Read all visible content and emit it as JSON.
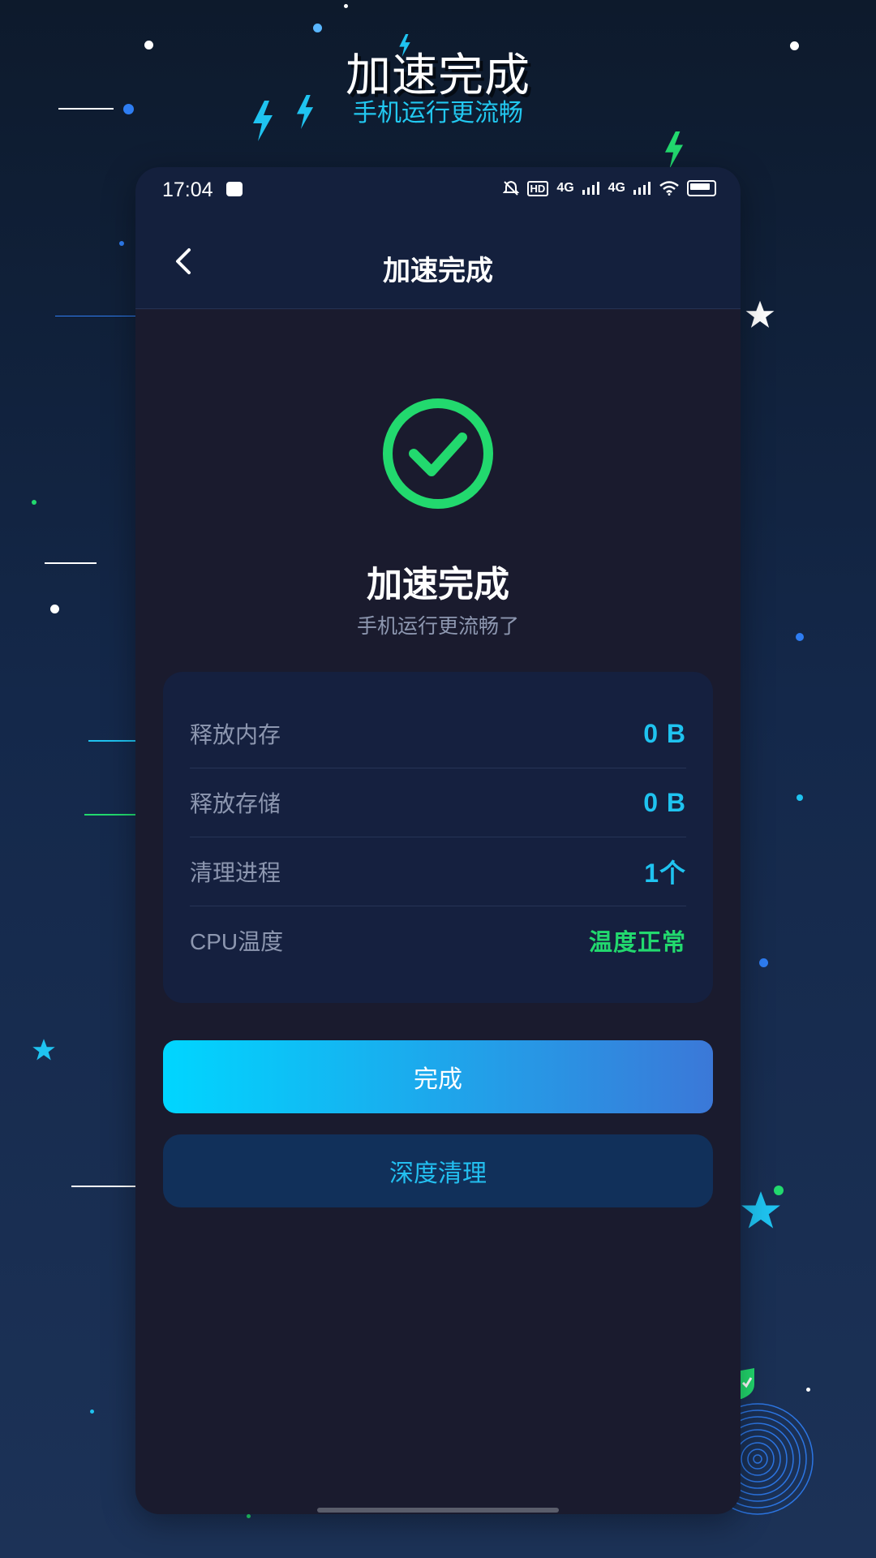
{
  "banner": {
    "title": "加速完成",
    "subtitle": "手机运行更流畅"
  },
  "status_bar": {
    "time": "17:04",
    "network_labels": [
      "HD",
      "4G",
      "4G"
    ]
  },
  "header": {
    "title": "加速完成",
    "back_icon": "chevron-left-icon"
  },
  "result": {
    "icon": "check-circle-icon",
    "title": "加速完成",
    "subtitle": "手机运行更流畅了"
  },
  "stats": [
    {
      "label": "释放内存",
      "value": "0 B"
    },
    {
      "label": "释放存储",
      "value": "0 B"
    },
    {
      "label": "清理进程",
      "value": "1个"
    },
    {
      "label": "CPU温度",
      "value": "温度正常"
    }
  ],
  "buttons": {
    "primary_label": "完成",
    "secondary_label": "深度清理"
  },
  "colors": {
    "accent": "#1fc3f0",
    "success": "#22d96e",
    "background": "#1a1b2e",
    "card": "#15203f"
  }
}
